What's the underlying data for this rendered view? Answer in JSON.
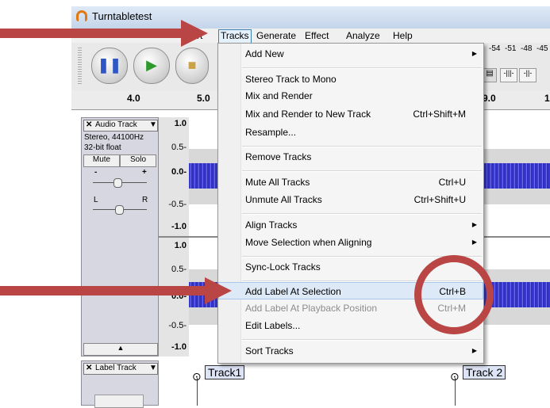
{
  "window": {
    "title": "Turntabletest"
  },
  "menubar": {
    "items": [
      "rt",
      "Tracks",
      "Generate",
      "Effect",
      "Analyze",
      "Help"
    ]
  },
  "ruler": {
    "labels": [
      "4.0",
      "5.0",
      "9.0",
      "1"
    ]
  },
  "meter": {
    "labels": [
      "-54",
      "-51",
      "-48",
      "-45"
    ]
  },
  "audio_track": {
    "name": "Audio Track",
    "info_line1": "Stereo, 44100Hz",
    "info_line2": "32-bit float",
    "mute_label": "Mute",
    "solo_label": "Solo",
    "gain_minus": "-",
    "gain_plus": "+",
    "pan_left": "L",
    "pan_right": "R",
    "scale": [
      "1.0",
      "0.5-",
      "0.0-",
      "-0.5-",
      "-1.0",
      "1.0",
      "0.5-",
      "0.0-",
      "-0.5-",
      "-1.0"
    ]
  },
  "label_track": {
    "name": "Label Track",
    "labels": [
      "Track1",
      "Track 2"
    ]
  },
  "tracks_menu": {
    "items": [
      {
        "label": "Add New",
        "shortcut": "",
        "submenu": true
      },
      {
        "label": "Stereo Track to Mono",
        "shortcut": ""
      },
      {
        "label": "Mix and Render",
        "shortcut": ""
      },
      {
        "label": "Mix and Render to New Track",
        "shortcut": "Ctrl+Shift+M"
      },
      {
        "label": "Resample...",
        "shortcut": ""
      },
      {
        "label": "Remove Tracks",
        "shortcut": ""
      },
      {
        "label": "Mute All Tracks",
        "shortcut": "Ctrl+U"
      },
      {
        "label": "Unmute All Tracks",
        "shortcut": "Ctrl+Shift+U"
      },
      {
        "label": "Align Tracks",
        "shortcut": "",
        "submenu": true
      },
      {
        "label": "Move Selection when Aligning",
        "shortcut": "",
        "submenu": true
      },
      {
        "label": "Sync-Lock Tracks",
        "shortcut": ""
      },
      {
        "label": "Add Label At Selection",
        "shortcut": "Ctrl+B",
        "highlighted": true
      },
      {
        "label": "Add Label At Playback Position",
        "shortcut": "Ctrl+M",
        "disabled": true
      },
      {
        "label": "Edit Labels...",
        "shortcut": ""
      },
      {
        "label": "Sort Tracks",
        "shortcut": "",
        "submenu": true
      }
    ]
  },
  "colors": {
    "annotation": "#b94545",
    "waveform": "#3a3ad0",
    "menu_highlight": "#dde9f6"
  }
}
